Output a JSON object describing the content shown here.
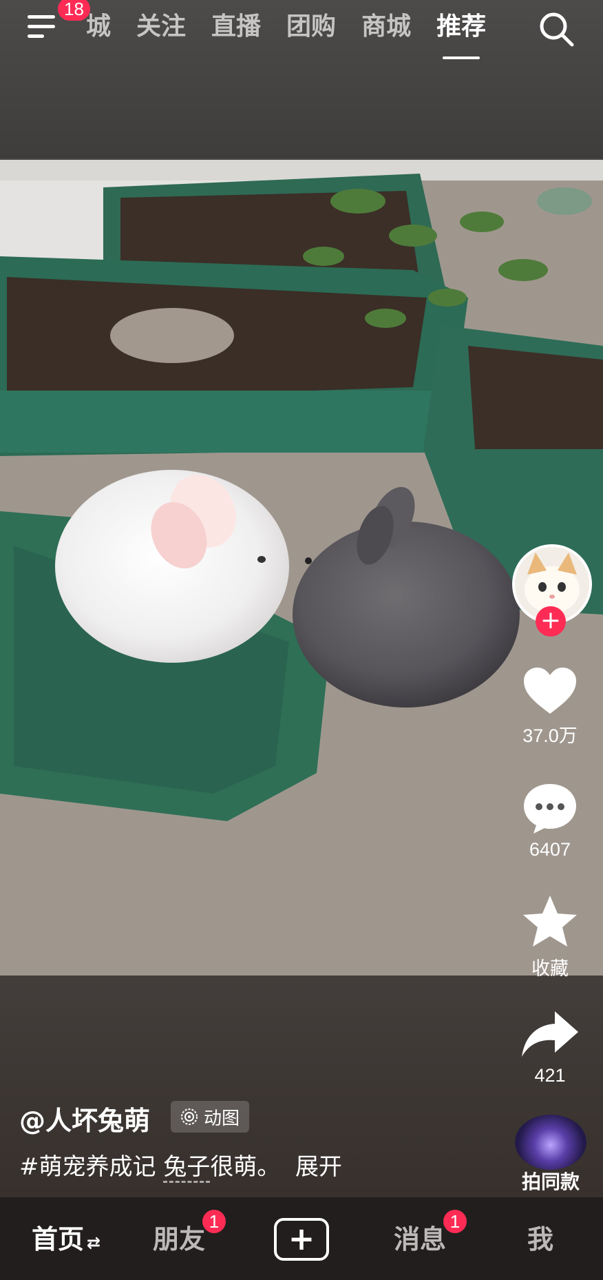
{
  "colors": {
    "accent": "#fe2c55",
    "background": "#4a4847",
    "nav_background": "#221e1d"
  },
  "header": {
    "menu_badge": "18",
    "tabs": [
      "城",
      "关注",
      "直播",
      "团购",
      "商城",
      "推荐"
    ],
    "active_tab": "推荐"
  },
  "video": {
    "author": "@人坏兔萌",
    "format_label": "动图",
    "caption_tag": "#萌宠养成记",
    "caption_linked_word": "兔子",
    "caption_text": "很萌。",
    "expand_label": "展开"
  },
  "actions": {
    "likes": "37.0万",
    "comments": "6407",
    "favorite_label": "收藏",
    "shares": "421",
    "same_style_label": "拍同款"
  },
  "bottom_nav": {
    "home": "首页",
    "home_switch_icon": "⇄",
    "friends": "朋友",
    "friends_badge": "1",
    "create_icon": "+",
    "messages": "消息",
    "messages_badge": "1",
    "me": "我"
  }
}
